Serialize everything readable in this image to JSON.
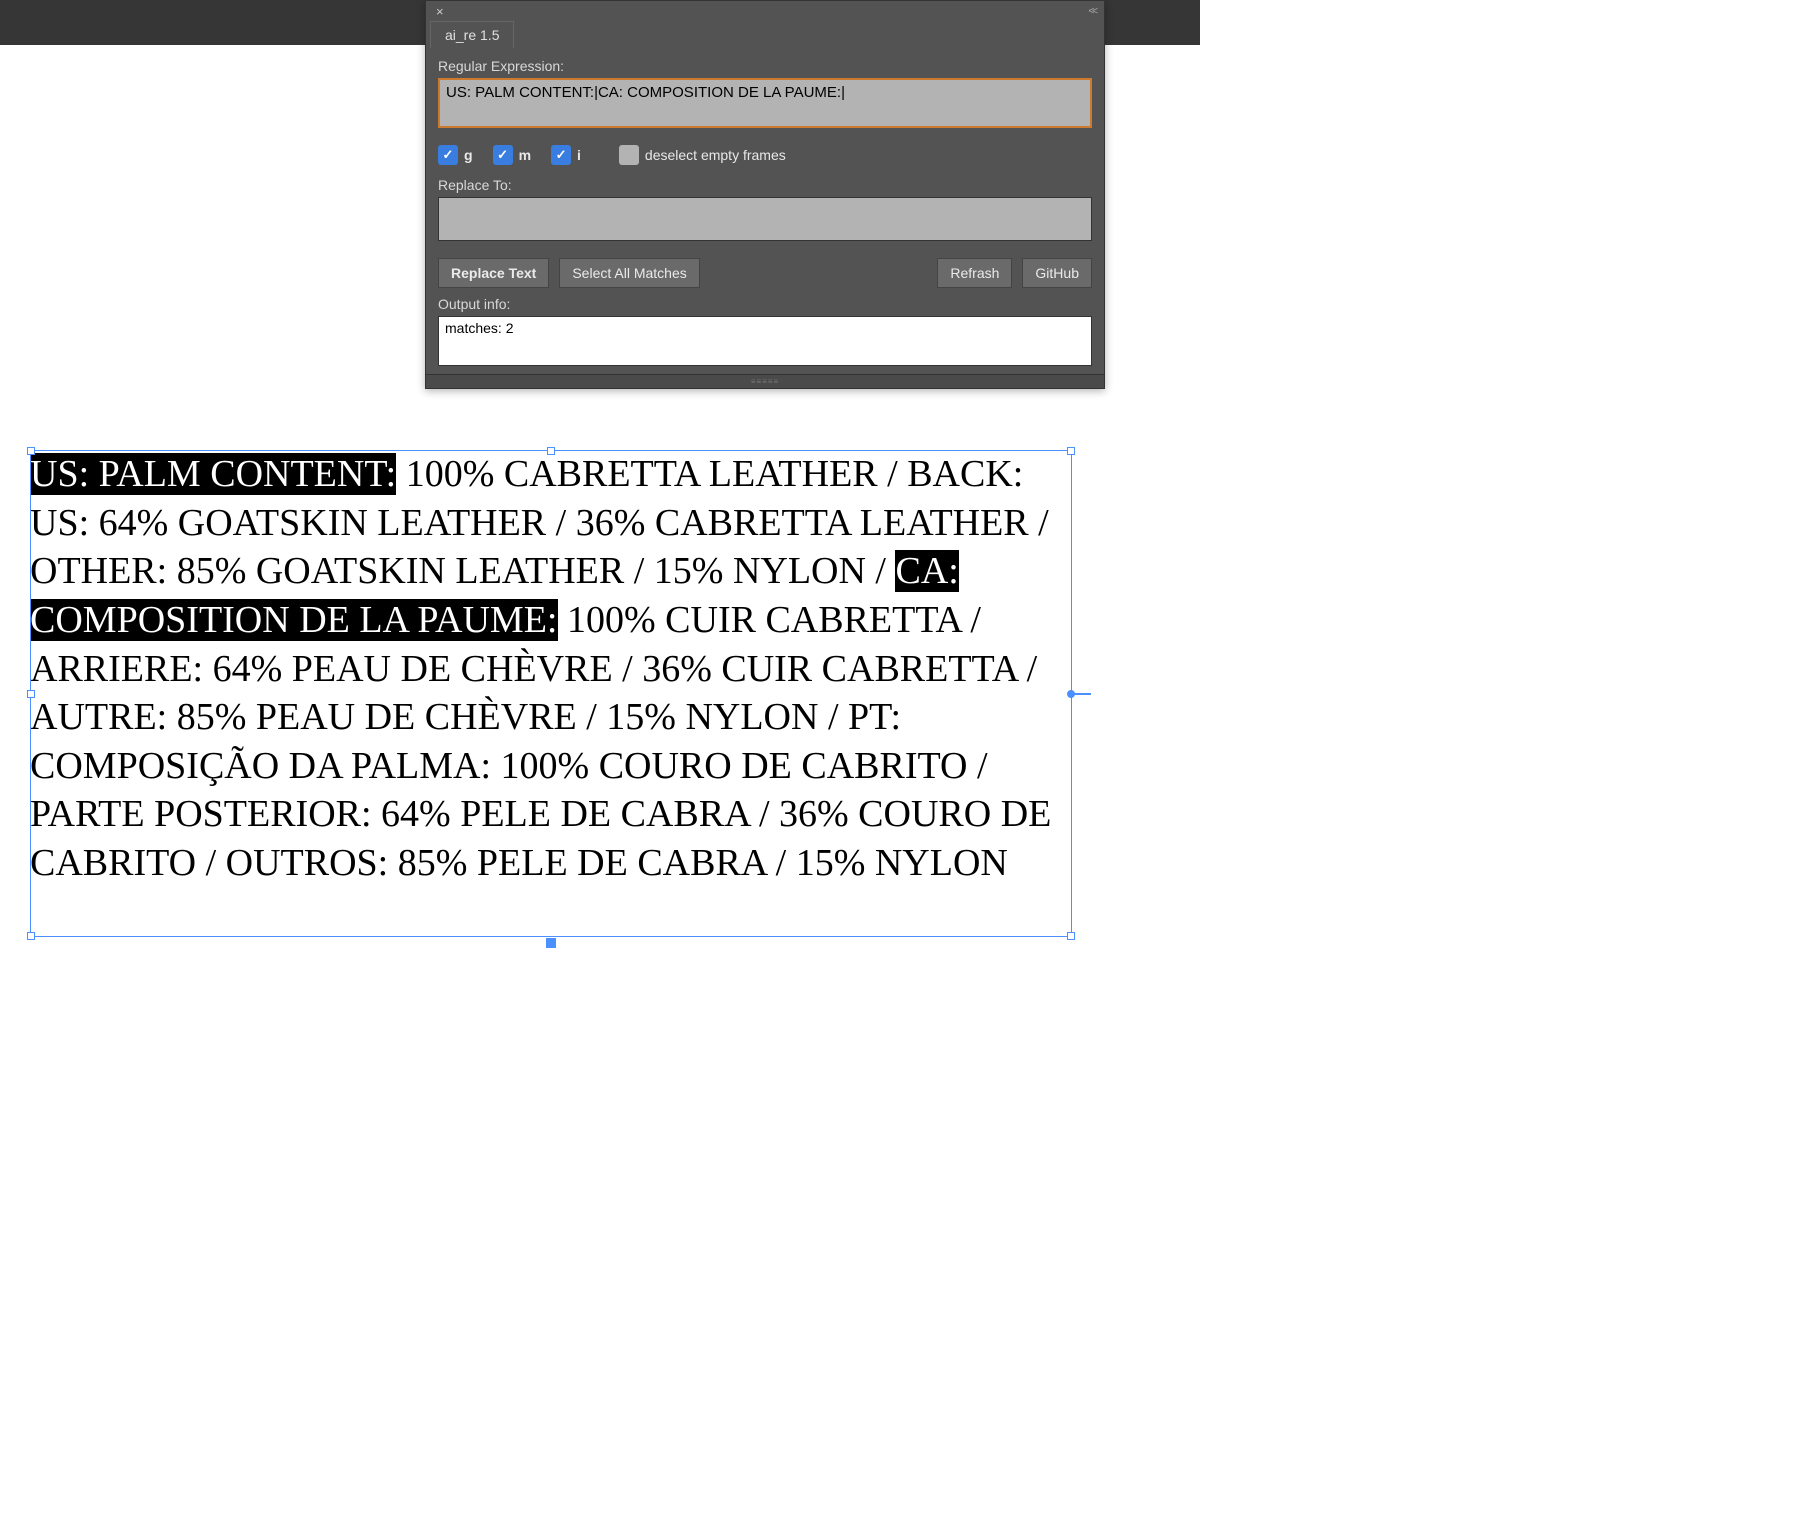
{
  "topbar": {},
  "panel": {
    "title": "ai_re 1.5",
    "regex_label": "Regular Expression:",
    "regex_value": "US: PALM CONTENT:|CA: COMPOSITION DE LA PAUME:|",
    "flags": {
      "g": {
        "label": "g",
        "checked": true
      },
      "m": {
        "label": "m",
        "checked": true
      },
      "i": {
        "label": "i",
        "checked": true
      }
    },
    "deselect": {
      "label": "deselect empty frames",
      "checked": false
    },
    "replace_label": "Replace To:",
    "replace_value": "",
    "buttons": {
      "replace": "Replace Text",
      "select_all": "Select All Matches",
      "refresh": "Refrash",
      "github": "GitHub"
    },
    "output_label": "Output info:",
    "output_value": "matches: 2"
  },
  "textframe": {
    "segs": [
      {
        "t": "US: PALM CONTENT:",
        "hl": true
      },
      {
        "t": " 100% CABRETTA LEATHER / BACK: US: 64% GOATSKIN LEATHER / 36% CABRETTA LEATHER / OTHER: 85% GOATSKIN LEATHER / 15% NYLON / ",
        "hl": false
      },
      {
        "t": "CA: COMPOSITION DE LA PAUME:",
        "hl": true
      },
      {
        "t": " 100% CUIR  CABRETTA / ARRIERE: 64% PEAU DE CHÈVRE / 36% CUIR CABRETTA / AUTRE: 85% PEAU DE CHÈVRE / 15%  NYLON / PT: COMPOSIÇÃO DA PALMA: 100% COURO DE CABRITO / PARTE POSTERIOR: 64% PELE DE  CABRA / 36% COURO DE CABRITO / OUTROS: 85% PELE DE CABRA / 15% NYLON",
        "hl": false
      }
    ]
  }
}
